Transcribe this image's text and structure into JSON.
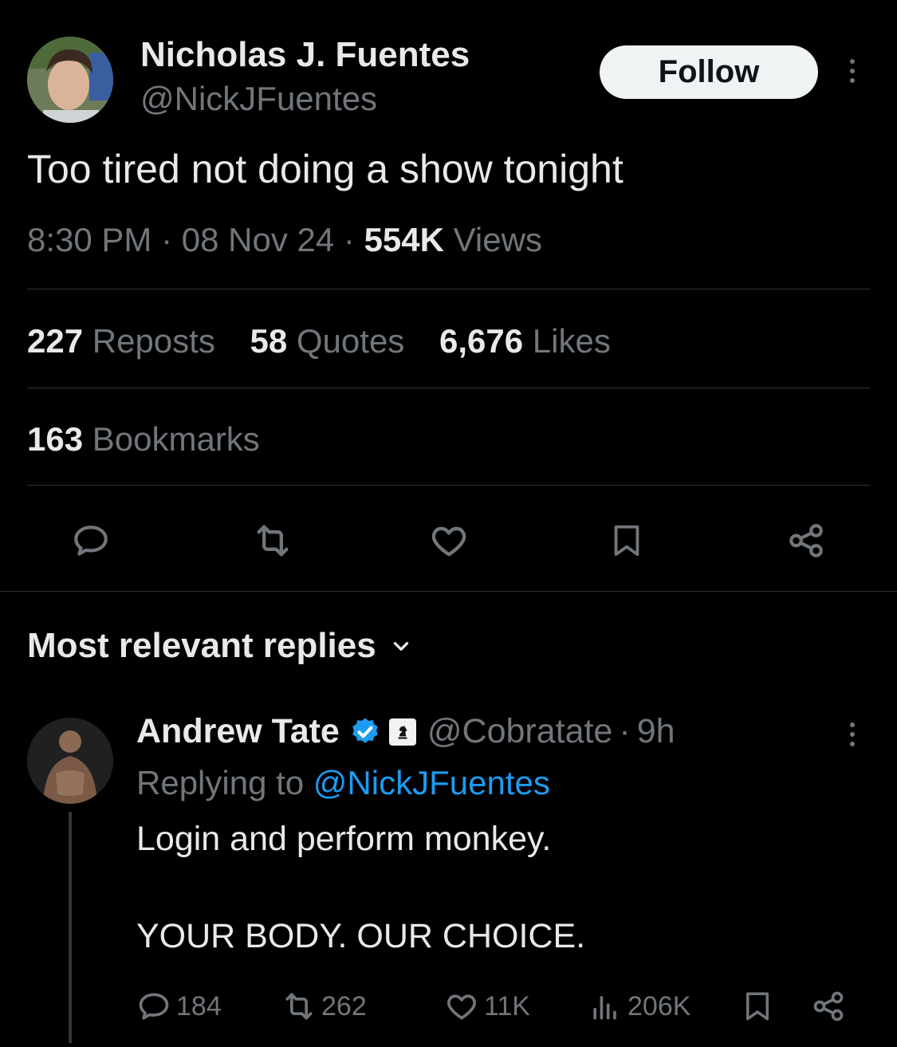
{
  "tweet": {
    "author_name": "Nicholas J. Fuentes",
    "author_handle": "@NickJFuentes",
    "follow_label": "Follow",
    "text": "Too tired not doing a show tonight",
    "time": "8:30 PM",
    "sep1": "·",
    "date": "08 Nov 24",
    "sep2": "·",
    "views_count": "554K",
    "views_label": "Views"
  },
  "stats": {
    "reposts_count": "227",
    "reposts_label": "Reposts",
    "quotes_count": "58",
    "quotes_label": "Quotes",
    "likes_count": "6,676",
    "likes_label": "Likes",
    "bookmarks_count": "163",
    "bookmarks_label": "Bookmarks"
  },
  "actions": {
    "icons": [
      "reply-icon",
      "repost-icon",
      "like-icon",
      "bookmark-icon",
      "share-icon"
    ]
  },
  "replies_section": {
    "title": "Most relevant replies"
  },
  "reply": {
    "author_name": "Andrew Tate",
    "author_handle": "@Cobratate",
    "sep": "·",
    "time": "9h",
    "replying_prefix": "Replying to",
    "replying_mention": "@NickJFuentes",
    "line1": "Login and perform monkey.",
    "line2": "YOUR BODY. OUR CHOICE.",
    "replies": "184",
    "reposts": "262",
    "likes": "11K",
    "views": "206K"
  },
  "colors": {
    "background": "#000000",
    "text_primary": "#e7e9ea",
    "text_secondary": "#71767b",
    "divider": "#2f3336",
    "accent_blue": "#1d9bf0",
    "follow_bg": "#eff3f4"
  }
}
